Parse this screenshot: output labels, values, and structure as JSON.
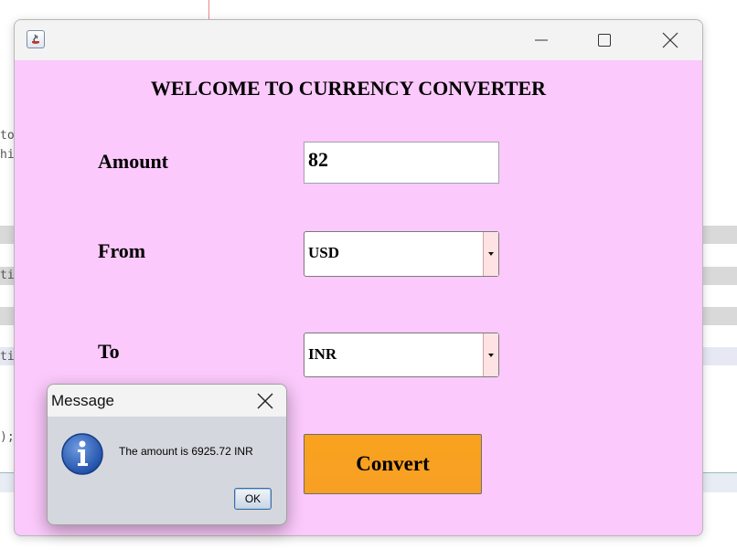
{
  "background": {
    "code_fragments": [
      "to",
      "hi",
      "ti",
      "ti",
      ");"
    ]
  },
  "window": {
    "title_buttons": {
      "minimize": "minimize-icon",
      "maximize": "maximize-icon",
      "close": "close-icon"
    },
    "background_color": "#fbc9fb",
    "heading": "WELCOME TO CURRENCY CONVERTER",
    "fields": {
      "amount_label": "Amount",
      "amount_value": "82",
      "from_label": "From",
      "from_value": "USD",
      "to_label": "To",
      "to_value": "INR"
    },
    "convert_button": {
      "label": "Convert",
      "color": "#f7a024"
    }
  },
  "dialog": {
    "title": "Message",
    "icon": "information-icon",
    "message": "The amount is 6925.72 INR",
    "ok_label": "OK"
  }
}
